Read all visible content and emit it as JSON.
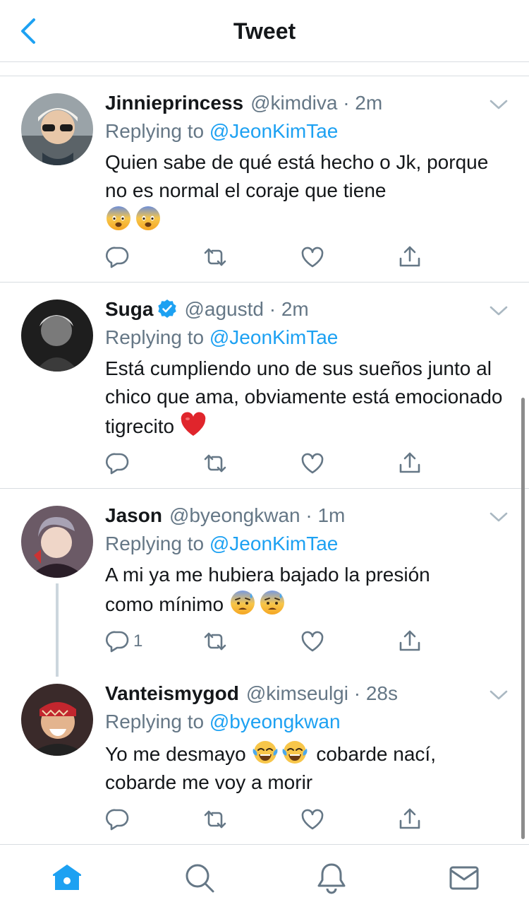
{
  "header": {
    "title": "Tweet"
  },
  "colors": {
    "accent": "#1da1f2",
    "secondary_text": "#657786",
    "border": "#d8dde1"
  },
  "tweets": [
    {
      "name": "Jinnieprincess",
      "handle": "@kimdiva · 2m",
      "replying_prefix": "Replying to",
      "replying_to": "@JeonKimTae",
      "text": "Quien sabe de qué está hecho o Jk, porque no es normal el coraje que tiene",
      "emojis": [
        "fearful-face",
        "fearful-face"
      ],
      "reply_count": ""
    },
    {
      "name": "Suga",
      "verified": true,
      "handle": "@agustd · 2m",
      "replying_prefix": "Replying to",
      "replying_to": "@JeonKimTae",
      "text": "Está cumpliendo uno de sus sueños junto al chico que ama, obviamente está emocionado tigrecito",
      "emojis": [
        "red-heart"
      ],
      "reply_count": ""
    },
    {
      "name": "Jason",
      "handle": "@byeongkwan · 1m",
      "replying_prefix": "Replying to",
      "replying_to": "@JeonKimTae",
      "text_line1": "A mi ya me hubiera bajado la presión",
      "text_line2": "como mínimo",
      "emojis": [
        "anxious-face-with-sweat",
        "anxious-face-with-sweat"
      ],
      "reply_count": "1"
    },
    {
      "name": "Vanteismygod",
      "handle": "@kimseulgi · 28s",
      "replying_prefix": "Replying to",
      "replying_to": "@byeongkwan",
      "text_before": "Yo me desmayo",
      "emojis": [
        "face-with-tears-of-joy",
        "face-with-tears-of-joy"
      ],
      "text_after": "cobarde nací,",
      "text_line2": "cobarde me voy a morir",
      "reply_count": ""
    }
  ],
  "tabbar": {
    "items": [
      "home",
      "search",
      "notifications",
      "messages"
    ],
    "active": "home"
  }
}
